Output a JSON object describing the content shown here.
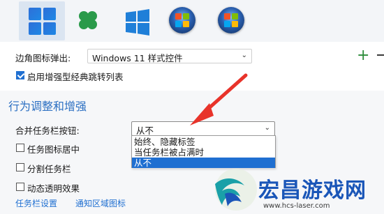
{
  "corner_icons": {
    "label": "边角图标弹出:",
    "value": "Windows 11 样式控件"
  },
  "enhanced_jump_list": {
    "label": "启用增强型经典跳转列表",
    "checked": true
  },
  "section": {
    "title": "行为调整和增强"
  },
  "merge_taskbar": {
    "label": "合并任务栏按钮:",
    "value": "从不",
    "options": [
      "始终、隐藏标签",
      "当任务栏被占满时",
      "从不"
    ],
    "selected_index": 2
  },
  "checkboxes": [
    {
      "label": "任务图标居中",
      "checked": false
    },
    {
      "label": "分割任务栏",
      "checked": false
    },
    {
      "label": "动态透明效果",
      "checked": false
    }
  ],
  "links": [
    {
      "label": "任务栏设置"
    },
    {
      "label": "通知区域图标"
    }
  ],
  "watermark": {
    "title": "宏昌游戏网",
    "url": "www.hcs-laser.com"
  },
  "colors": {
    "accent": "#1f6fd1",
    "section_title": "#2b6fc2",
    "arrow": "#e8332a",
    "plus": "#2c8c3a"
  },
  "icons": [
    "windows-11-logo-icon",
    "clover-icon",
    "windows-10-logo-icon",
    "windows-7-orb-icon",
    "windows-vista-orb-icon",
    "plus-icon",
    "minus-icon",
    "chevron-down-icon"
  ]
}
